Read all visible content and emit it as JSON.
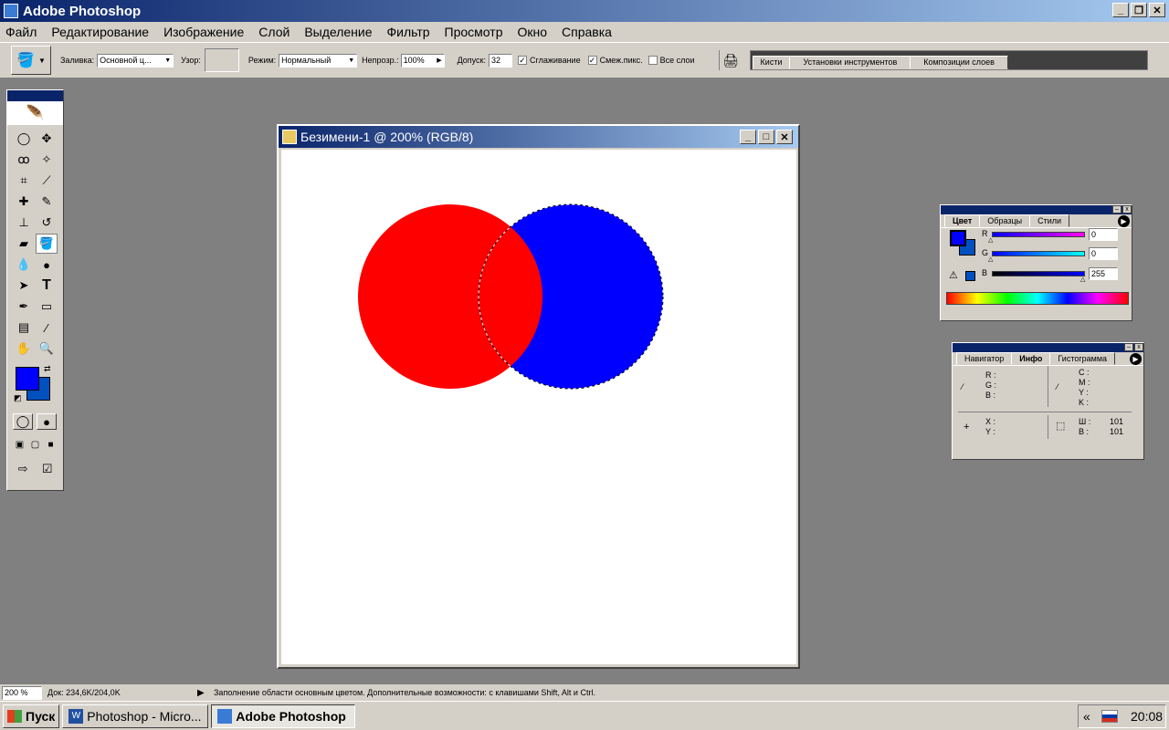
{
  "app": {
    "title": "Adobe Photoshop"
  },
  "menu": [
    "Файл",
    "Редактирование",
    "Изображение",
    "Слой",
    "Выделение",
    "Фильтр",
    "Просмотр",
    "Окно",
    "Справка"
  ],
  "options": {
    "fill_label": "Заливка:",
    "fill_value": "Основной ц...",
    "pattern_label": "Узор:",
    "mode_label": "Режим:",
    "mode_value": "Нормальный",
    "opacity_label": "Непрозр.:",
    "opacity_value": "100%",
    "tolerance_label": "Допуск:",
    "tolerance_value": "32",
    "antialias_label": "Сглаживание",
    "contiguous_label": "Смеж.пикс.",
    "all_layers_label": "Все слои",
    "palette_tabs": [
      "Кисти",
      "Установки инструментов",
      "Композиции слоев"
    ]
  },
  "document": {
    "title": "Безимени-1 @ 200% (RGB/8)",
    "red": "#ff0000",
    "blue": "#0000ff"
  },
  "color_panel": {
    "tabs": [
      "Цвет",
      "Образцы",
      "Стили"
    ],
    "r_label": "R",
    "r_value": "0",
    "g_label": "G",
    "g_value": "0",
    "b_label": "B",
    "b_value": "255",
    "fg": "#0000ff",
    "bg": "#0050c0"
  },
  "info_panel": {
    "tabs": [
      "Навигатор",
      "Инфо",
      "Гистограмма"
    ],
    "rgb": [
      "R :",
      "G :",
      "B :"
    ],
    "cmyk": [
      "C :",
      "M :",
      "Y :",
      "K :"
    ],
    "xy": [
      "X :",
      "Y :"
    ],
    "wh_labels": [
      "Ш :",
      "В :"
    ],
    "wh_values": [
      "101",
      "101"
    ]
  },
  "status": {
    "zoom": "200 %",
    "doc": "Док: 234,6K/204,0K",
    "hint": "Заполнение области основным цветом. Дополнительные возможности: с клавишами Shift, Alt и Ctrl."
  },
  "taskbar": {
    "start": "Пуск",
    "items": [
      "Photoshop - Micro...",
      "Adobe Photoshop"
    ],
    "clock": "20:08",
    "tray_arrow": "«"
  }
}
